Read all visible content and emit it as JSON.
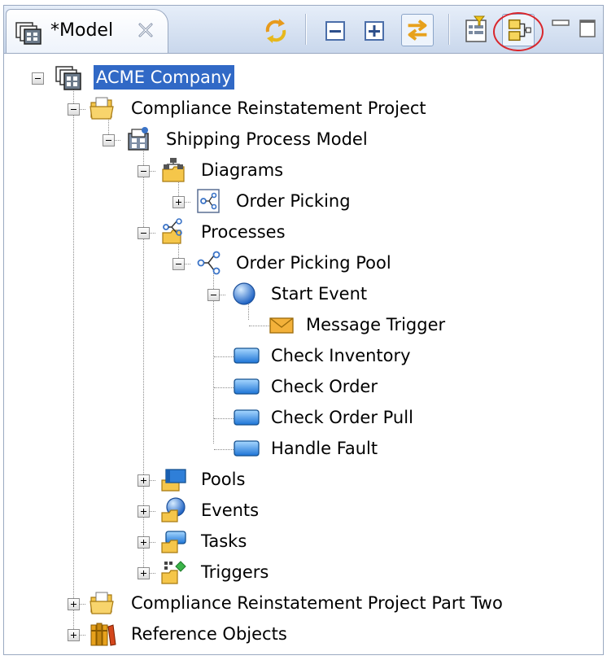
{
  "view": {
    "tab_title": "*Model",
    "tab_icon": "model-icon",
    "close_icon": "close-icon"
  },
  "toolbar": {
    "buttons": [
      {
        "name": "sync-icon",
        "pressed": false
      },
      {
        "name": "collapse-all-icon",
        "pressed": false
      },
      {
        "name": "expand-all-icon",
        "pressed": false
      },
      {
        "name": "link-with-editor-icon",
        "pressed": true
      },
      {
        "name": "filter-icon",
        "pressed": false
      },
      {
        "name": "hierarchy-view-icon",
        "pressed": false,
        "circled": true
      },
      {
        "name": "minimize-icon",
        "pressed": false
      },
      {
        "name": "maximize-icon",
        "pressed": false
      }
    ],
    "highlight_color": "#d9262c"
  },
  "tree": {
    "selection_color": "#3169c6",
    "nodes": [
      {
        "label": "ACME Company",
        "icon": "model-icon",
        "expanded": true,
        "selected": true
      },
      {
        "label": "Compliance Reinstatement Project",
        "icon": "project-folder-icon",
        "expanded": true
      },
      {
        "label": "Shipping Process Model",
        "icon": "process-model-icon",
        "expanded": true
      },
      {
        "label": "Diagrams",
        "icon": "diagrams-folder-icon",
        "expanded": true
      },
      {
        "label": "Order Picking",
        "icon": "diagram-icon",
        "expanded": false
      },
      {
        "label": "Processes",
        "icon": "processes-folder-icon",
        "expanded": true
      },
      {
        "label": "Order Picking Pool",
        "icon": "process-icon",
        "expanded": true
      },
      {
        "label": "Start Event",
        "icon": "start-event-icon",
        "expanded": true
      },
      {
        "label": "Message Trigger",
        "icon": "message-icon"
      },
      {
        "label": "Check Inventory",
        "icon": "task-icon"
      },
      {
        "label": "Check Order",
        "icon": "task-icon"
      },
      {
        "label": "Check Order Pull",
        "icon": "task-icon"
      },
      {
        "label": "Handle Fault",
        "icon": "task-icon"
      },
      {
        "label": "Pools",
        "icon": "pools-folder-icon",
        "expanded": false
      },
      {
        "label": "Events",
        "icon": "events-folder-icon",
        "expanded": false
      },
      {
        "label": "Tasks",
        "icon": "tasks-folder-icon",
        "expanded": false
      },
      {
        "label": "Triggers",
        "icon": "triggers-folder-icon",
        "expanded": false
      },
      {
        "label": "Compliance Reinstatement Project Part Two",
        "icon": "project-folder-icon",
        "expanded": false
      },
      {
        "label": "Reference Objects",
        "icon": "reference-objects-icon",
        "expanded": false
      }
    ]
  }
}
